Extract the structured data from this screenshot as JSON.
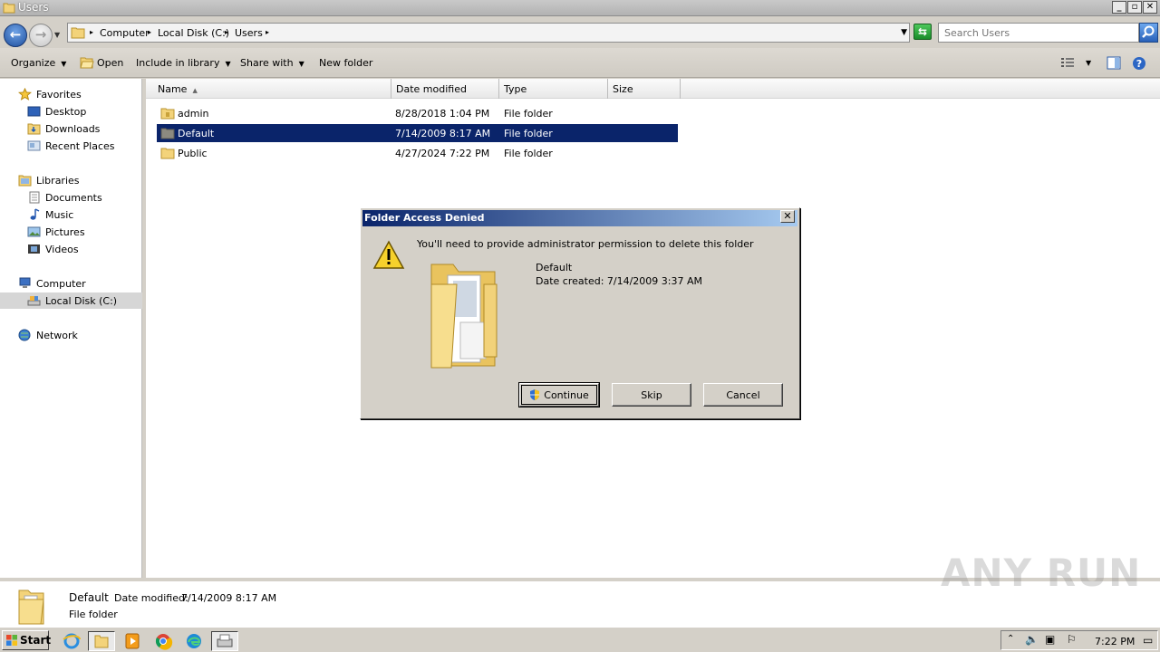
{
  "window": {
    "title": "Users"
  },
  "address": {
    "breadcrumbs": [
      "Computer",
      "Local Disk (C:)",
      "Users"
    ],
    "search_placeholder": "Search Users"
  },
  "toolbar": {
    "organize": "Organize",
    "open": "Open",
    "include_in_library": "Include in library",
    "share_with": "Share with",
    "new_folder": "New folder"
  },
  "nav": {
    "favorites": "Favorites",
    "desktop": "Desktop",
    "downloads": "Downloads",
    "recent_places": "Recent Places",
    "libraries": "Libraries",
    "documents": "Documents",
    "music": "Music",
    "pictures": "Pictures",
    "videos": "Videos",
    "computer": "Computer",
    "local_disk": "Local Disk (C:)",
    "network": "Network"
  },
  "columns": {
    "name": "Name",
    "date_modified": "Date modified",
    "type": "Type",
    "size": "Size"
  },
  "files": [
    {
      "name": "admin",
      "date": "8/28/2018 1:04 PM",
      "type": "File folder"
    },
    {
      "name": "Default",
      "date": "7/14/2009 8:17 AM",
      "type": "File folder"
    },
    {
      "name": "Public",
      "date": "4/27/2024 7:22 PM",
      "type": "File folder"
    }
  ],
  "details": {
    "name": "Default",
    "date_label": "Date modified:",
    "date_value": "7/14/2009 8:17 AM",
    "type": "File folder"
  },
  "dialog": {
    "title": "Folder Access Denied",
    "message": "You'll need to provide administrator permission to delete this folder",
    "item_name": "Default",
    "item_date": "Date created: 7/14/2009 3:37 AM",
    "continue": "Continue",
    "skip": "Skip",
    "cancel": "Cancel"
  },
  "taskbar": {
    "start": "Start",
    "time": "7:22 PM"
  },
  "watermark": "ANY RUN",
  "colors": {
    "selection": "#0a246a",
    "dialog_title_start": "#0a246a",
    "dialog_title_end": "#a6caf0",
    "folder": "#f3d37a"
  },
  "icons": [
    "folder-icon",
    "star-icon",
    "desktop-icon",
    "downloads-icon",
    "recent-places-icon",
    "library-icon",
    "documents-icon",
    "music-icon",
    "pictures-icon",
    "videos-icon",
    "computer-icon",
    "drive-icon",
    "network-icon",
    "warning-icon",
    "shield-icon",
    "search-icon",
    "refresh-icon",
    "help-icon",
    "start-flag-icon"
  ]
}
